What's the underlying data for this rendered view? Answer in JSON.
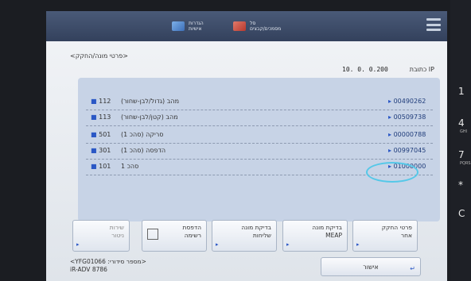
{
  "topbar": {
    "btn1": [
      "הגדרות",
      "אישיות"
    ],
    "btn2": [
      "סל",
      "מסמכים/קבצים"
    ]
  },
  "breadcrumb": "<פרטי מונה/החקק>",
  "ip_label": "כתובת IP",
  "ip_value": "10. 0. 0.200",
  "rows": [
    {
      "count": "112",
      "desc": "(גדול/לבן-שחור) מהב",
      "code": "00490262"
    },
    {
      "count": "113",
      "desc": "(קטן/לבן-שחור) מהב",
      "code": "00509738"
    },
    {
      "count": "501",
      "desc": "(1 סהכ) סריקה",
      "code": "00000788"
    },
    {
      "count": "301",
      "desc": "(1 סהכ) הדפסה",
      "code": "00997045"
    },
    {
      "count": "101",
      "desc": "1 סהכ",
      "code": "01000000"
    }
  ],
  "buttons": [
    {
      "lines": [
        "שירות",
        "ניטור"
      ]
    },
    {
      "lines": [
        "הדפסת",
        "רשימה"
      ]
    },
    {
      "lines": [
        "בדיקת מונה",
        "שליחות"
      ]
    },
    {
      "lines": [
        "בדיקת מונה",
        "MEAP"
      ]
    },
    {
      "lines": [
        "פרטי החקק",
        "אחר"
      ]
    }
  ],
  "serial": [
    "<YFG01066 :מספר סידורי>",
    "iR-ADV 8786"
  ],
  "ok_label": "אישור",
  "side_keys": [
    "1",
    "4",
    "7",
    "*",
    "C"
  ],
  "side_small": [
    "GHI",
    "PQRS"
  ]
}
